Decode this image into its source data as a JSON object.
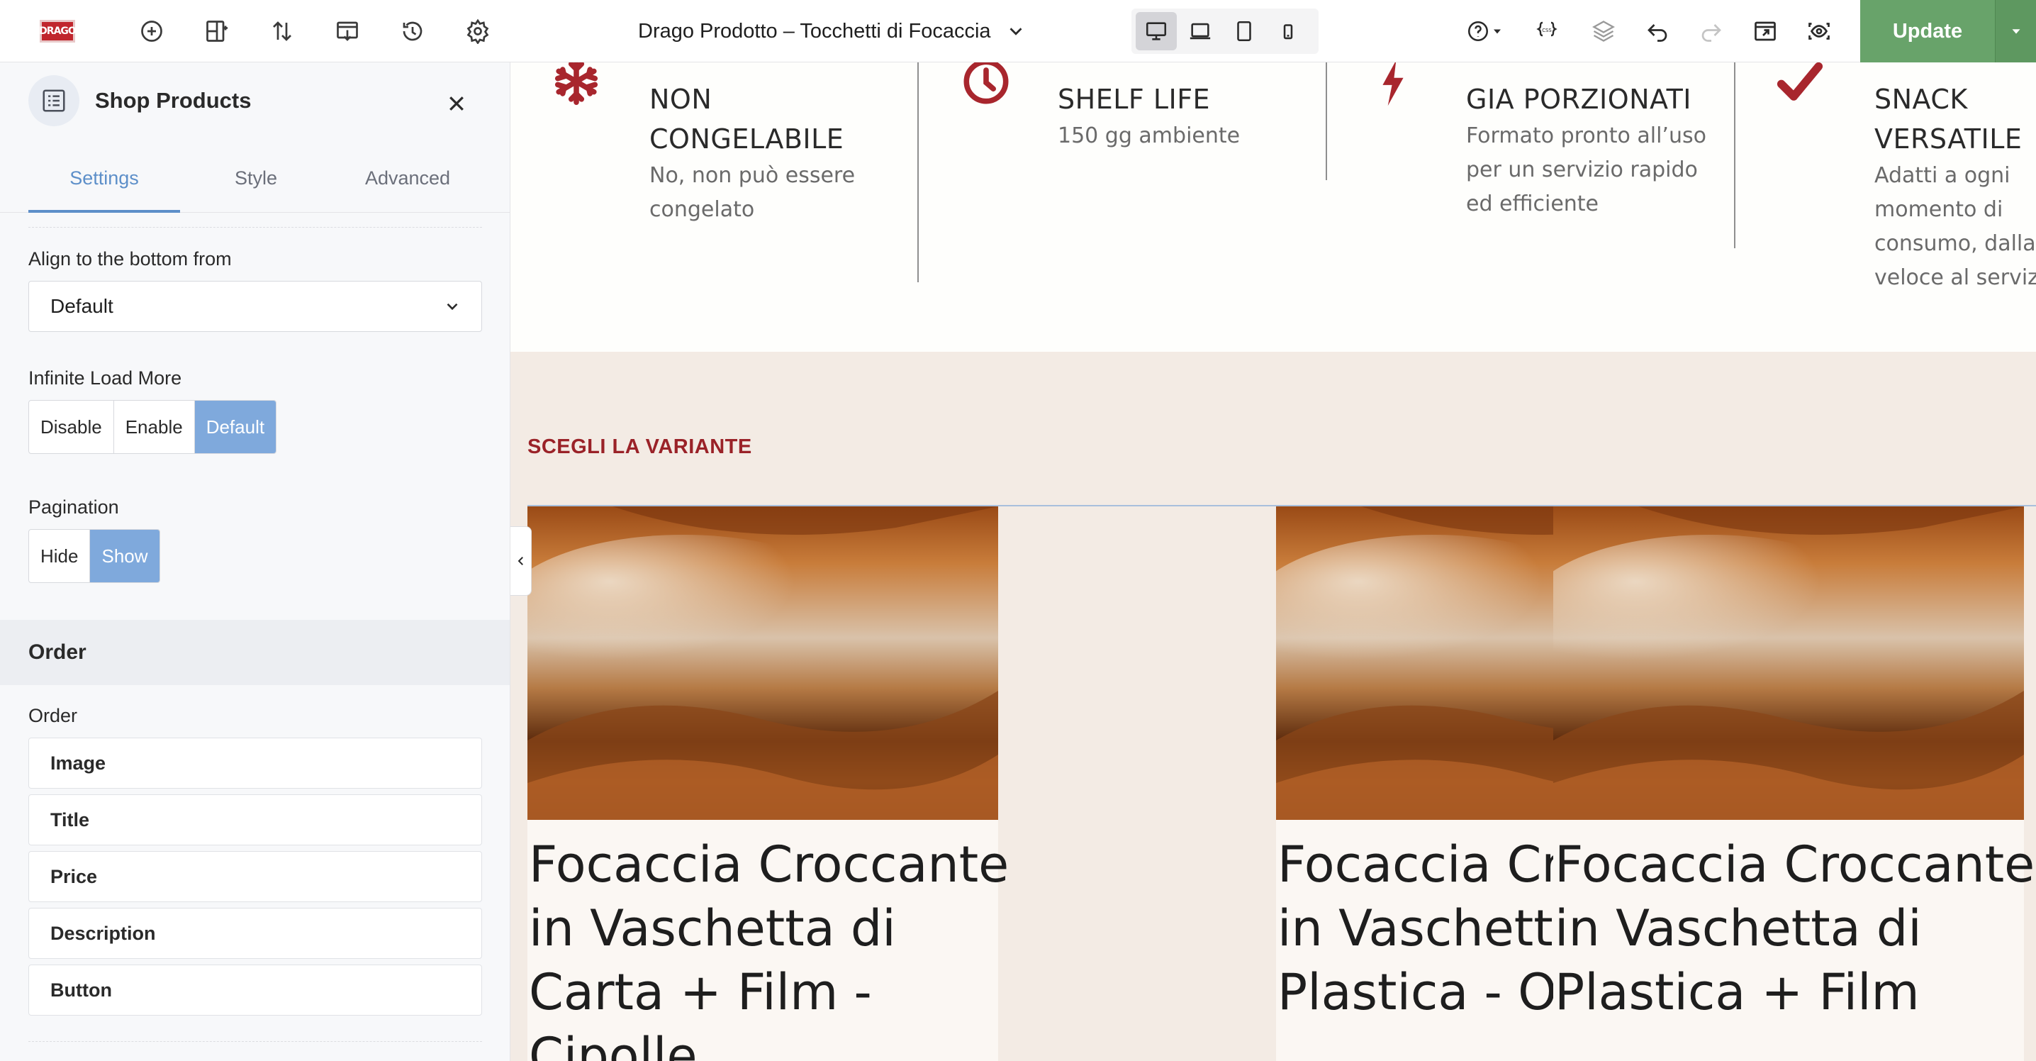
{
  "topbar": {
    "logo_text": "DRAGO",
    "document_title": "Drago Prodotto – Tocchetti di Focaccia",
    "update_label": "Update",
    "icons": [
      "add-element-icon",
      "layout-icon",
      "navigator-icon",
      "templates-icon",
      "history-icon",
      "settings-icon",
      "help-icon",
      "css-icon",
      "layers-icon",
      "undo-icon",
      "redo-icon",
      "preview-icon",
      "eye-icon"
    ],
    "devices": [
      "desktop",
      "laptop",
      "tablet",
      "mobile"
    ],
    "active_device": "desktop"
  },
  "sidebar": {
    "widget_title": "Shop Products",
    "tabs": [
      {
        "label": "Settings",
        "active": true
      },
      {
        "label": "Style",
        "active": false
      },
      {
        "label": "Advanced",
        "active": false
      }
    ],
    "align_bottom": {
      "label": "Align to the bottom from",
      "value": "Default"
    },
    "infinite_load": {
      "label": "Infinite Load More",
      "options": [
        "Disable",
        "Enable",
        "Default"
      ],
      "selected": "Default"
    },
    "pagination": {
      "label": "Pagination",
      "options": [
        "Hide",
        "Show"
      ],
      "selected": "Show"
    },
    "order_section": {
      "title": "Order"
    },
    "order": {
      "label": "Order",
      "items": [
        "Image",
        "Title",
        "Price",
        "Description",
        "Button"
      ]
    }
  },
  "canvas": {
    "features": [
      {
        "icon": "snowflake-icon",
        "title": "NON CONGELABILE",
        "description": "No, non può essere congelato"
      },
      {
        "icon": "clock-icon",
        "title": "SHELF LIFE",
        "description": "150 gg ambiente"
      },
      {
        "icon": "lightning-icon",
        "title": "GIA PORZIONATI",
        "description": "Formato pronto all’uso per un servizio rapido ed efficiente"
      },
      {
        "icon": "check-icon",
        "title": "SNACK VERSATILE",
        "description": "Adatti a ogni momento di consumo, dalla veloce al servizio"
      }
    ],
    "variant_heading": "SCEGLI LA VARIANTE",
    "products": [
      {
        "title": "Focaccia Croccante in Vaschetta di Carta + Film - Cipolle"
      },
      {
        "title": "Focaccia Croccante in Vaschetta di Plastica - Olio di"
      },
      {
        "title": "Focaccia Croccante in Vaschetta di Plastica + Film"
      }
    ]
  },
  "colors": {
    "accent_red": "#9a2228",
    "update_green": "#68a36a",
    "active_blue": "#7fa9dc",
    "band_beige": "#f3ebe4"
  }
}
